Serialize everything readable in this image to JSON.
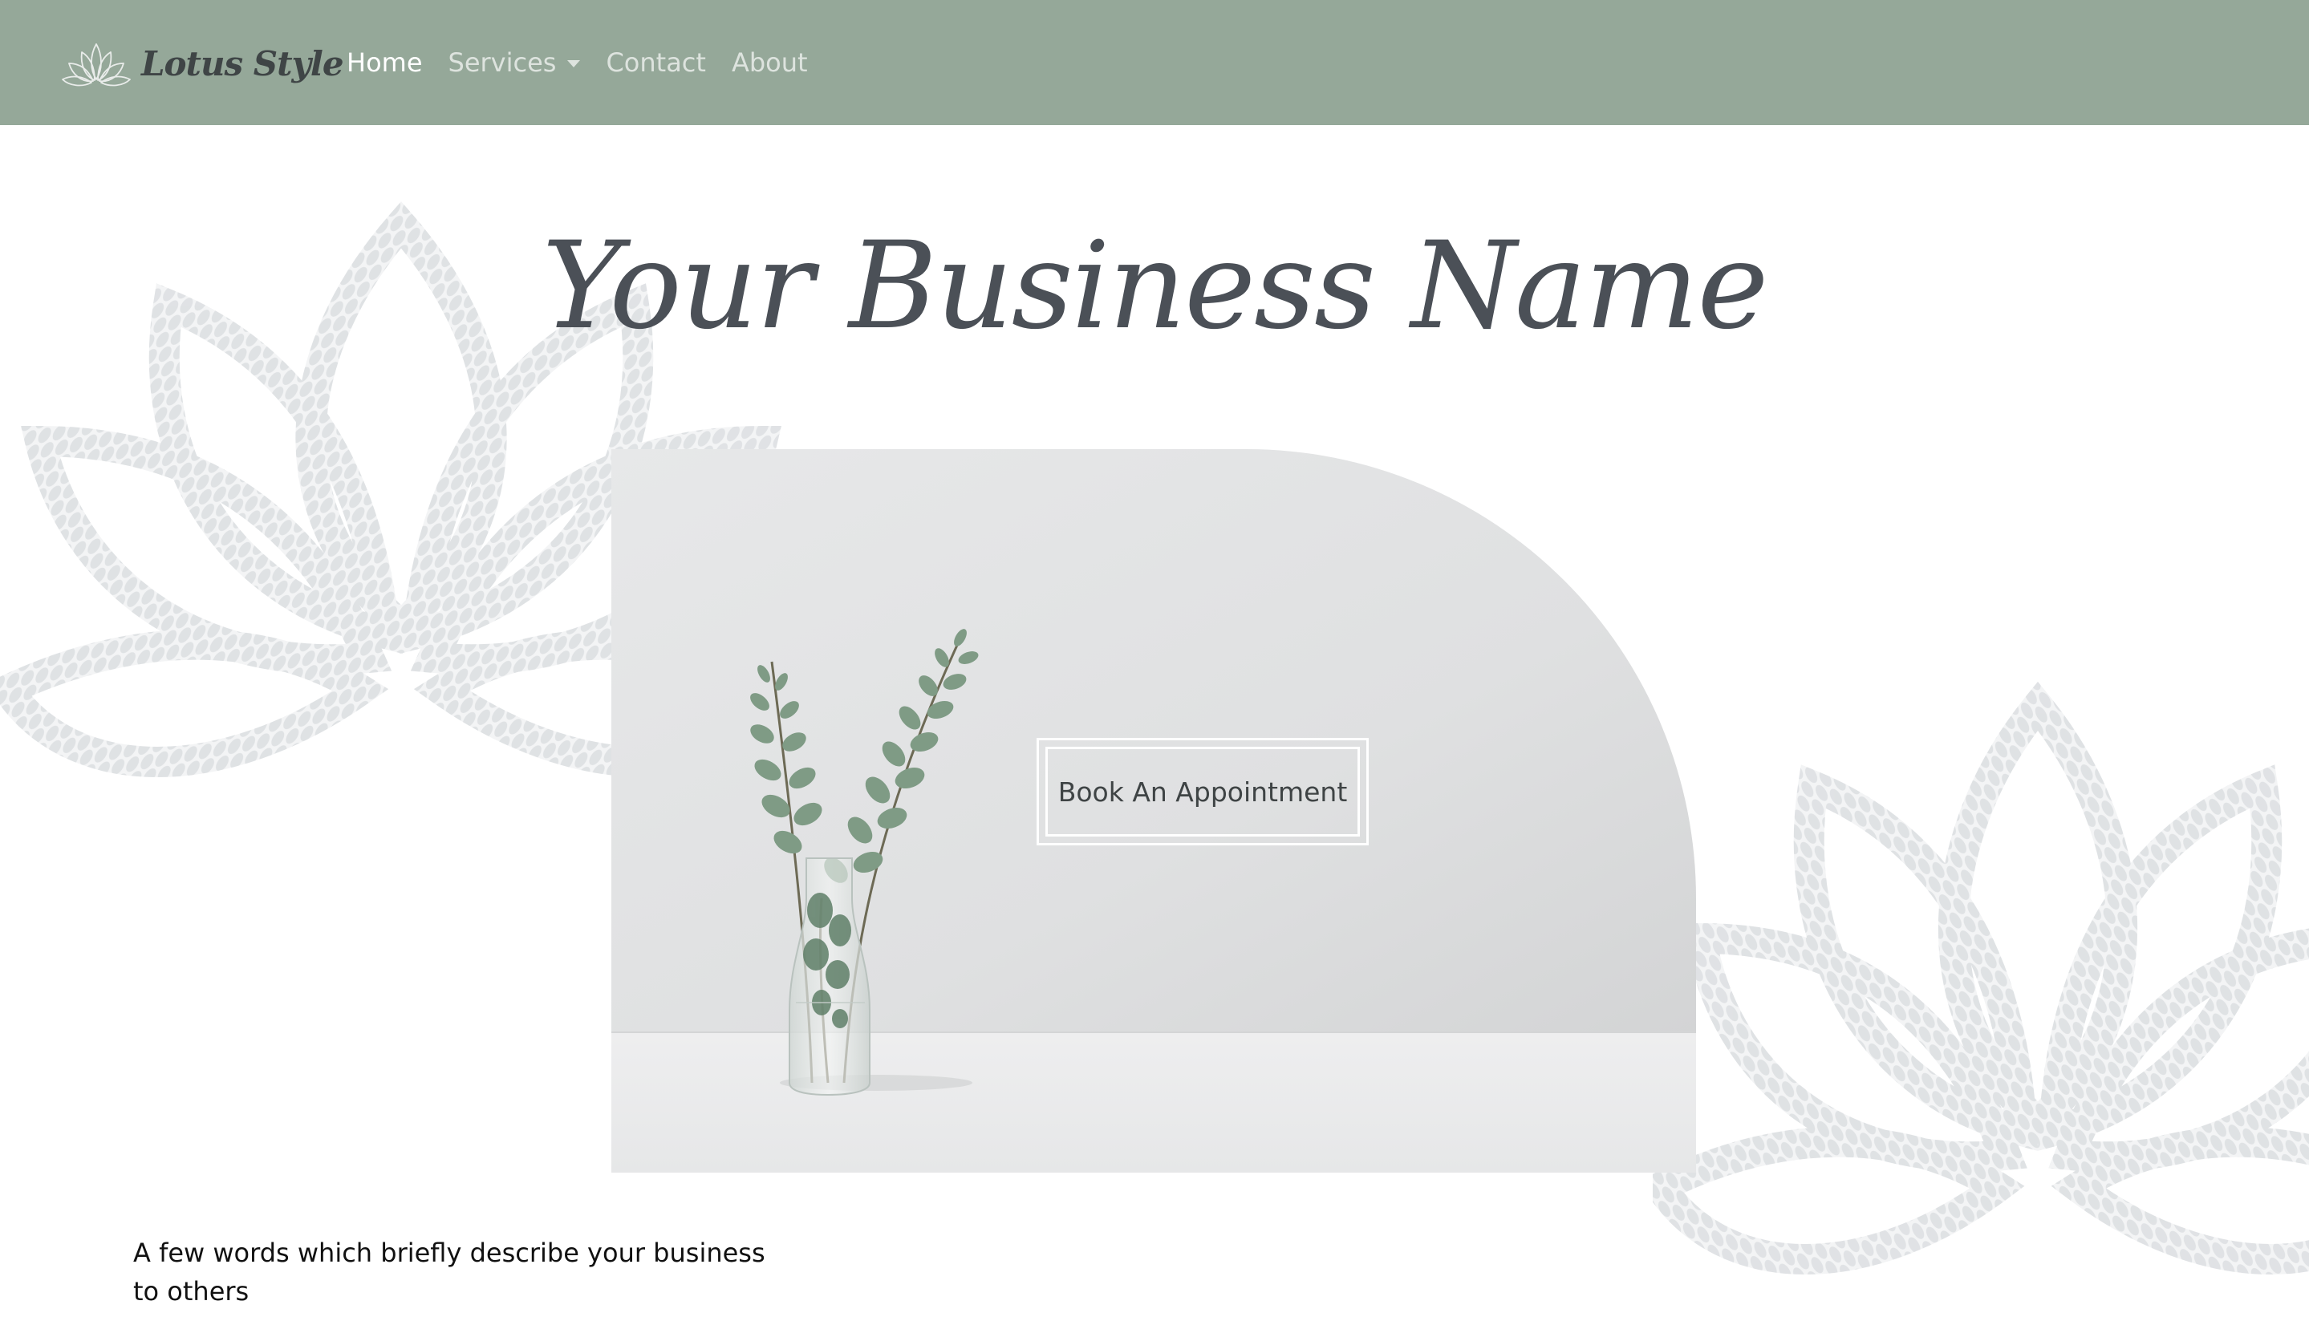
{
  "brand": {
    "name": "Lotus Style",
    "logo_icon": "lotus-icon"
  },
  "nav": {
    "items": [
      {
        "label": "Home",
        "active": true
      },
      {
        "label": "Services",
        "dropdown": true
      },
      {
        "label": "Contact"
      },
      {
        "label": "About"
      }
    ]
  },
  "hero": {
    "title": "Your Business Name",
    "cta_label": "Book An Appointment",
    "image_subject": "eucalyptus-vase-photo"
  },
  "tagline": "A few words which briefly describe your business to others",
  "colors": {
    "navbar": "#95a899",
    "brand_text": "#3f4546",
    "title_text": "#4b5057",
    "lotus_pattern": "#e6e8ea"
  }
}
